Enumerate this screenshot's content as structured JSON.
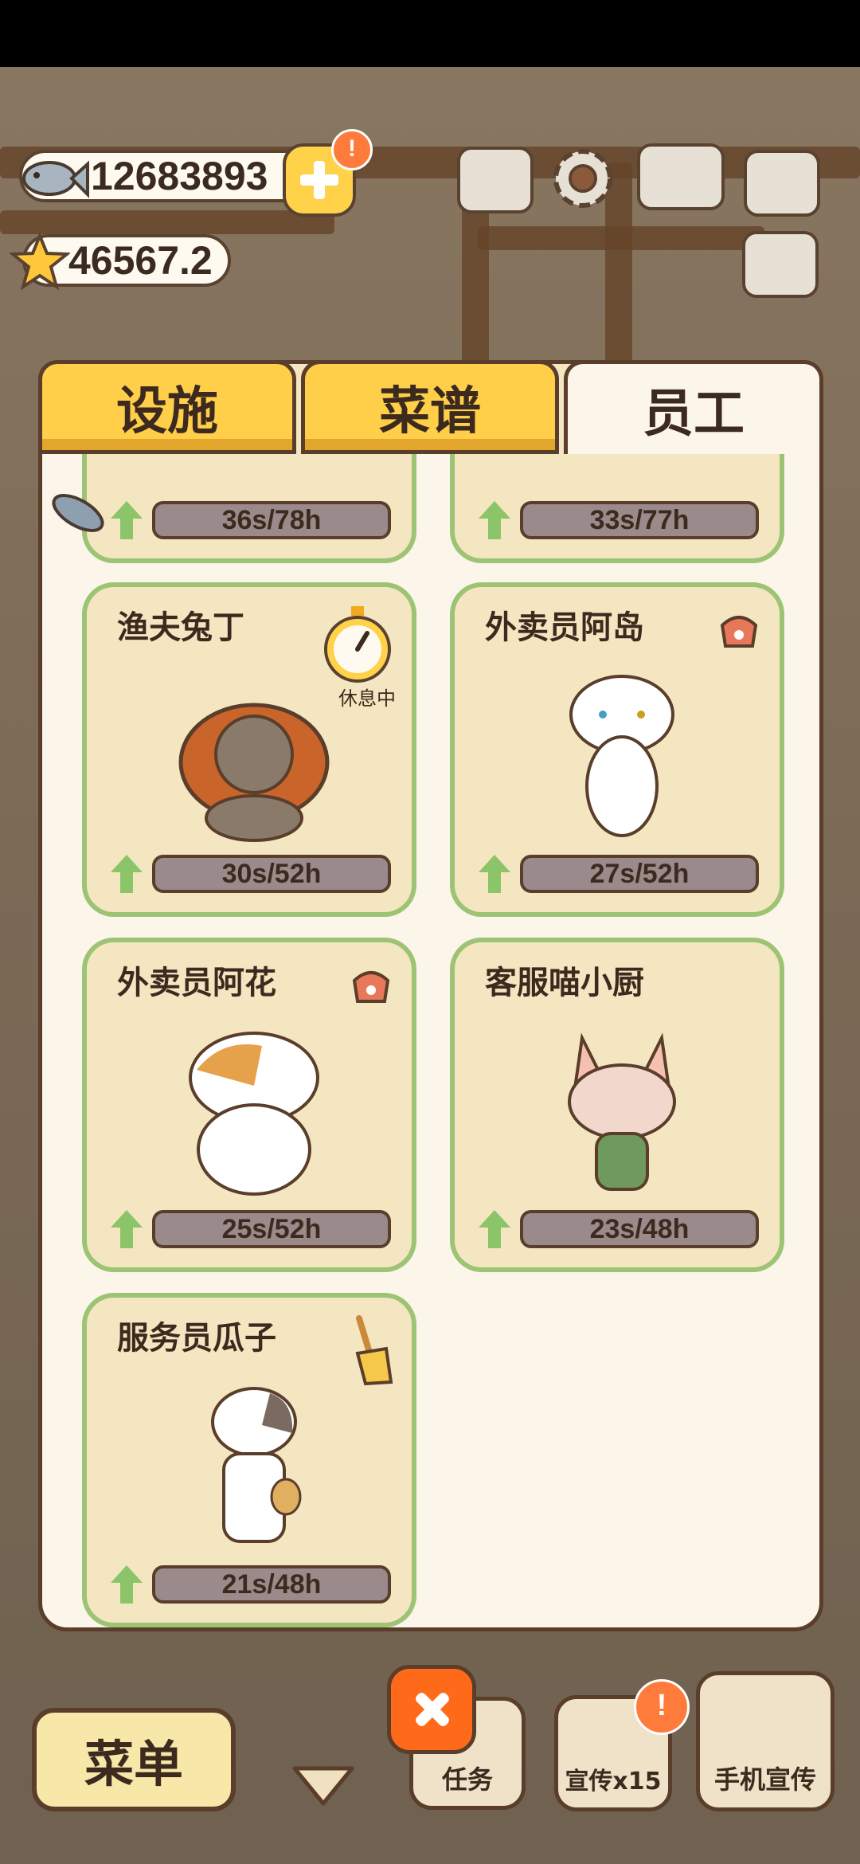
{
  "currency": {
    "fish_count": "12683893",
    "star_count": "46567.2",
    "add_badge": "!"
  },
  "tabs": [
    {
      "label": "设施",
      "active": false
    },
    {
      "label": "菜谱",
      "active": false
    },
    {
      "label": "员工",
      "active": true
    }
  ],
  "staff": [
    {
      "name": "",
      "progress": "36s/78h"
    },
    {
      "name": "",
      "progress": "33s/77h"
    },
    {
      "name": "渔夫兔丁",
      "progress": "30s/52h",
      "status_icon": "stopwatch-icon",
      "status_label": "休息中"
    },
    {
      "name": "外卖员阿岛",
      "progress": "27s/52h",
      "status_icon": "delivery-bag-icon"
    },
    {
      "name": "外卖员阿花",
      "progress": "25s/52h",
      "status_icon": "delivery-bag-icon"
    },
    {
      "name": "客服喵小厨",
      "progress": "23s/48h",
      "status_icon": ""
    },
    {
      "name": "服务员瓜子",
      "progress": "21s/48h",
      "status_icon": "broom-icon"
    }
  ],
  "bottom": {
    "menu_label": "菜单",
    "task_label": "任务",
    "promo_label": "宣传x15",
    "phone_promo_label": "手机宣传",
    "promo_badge": "!"
  },
  "colors": {
    "accent_yellow": "#ffcf4a",
    "card_border": "#9cc474",
    "panel_bg": "#fbf5ea",
    "close_orange": "#ff6a1a"
  }
}
